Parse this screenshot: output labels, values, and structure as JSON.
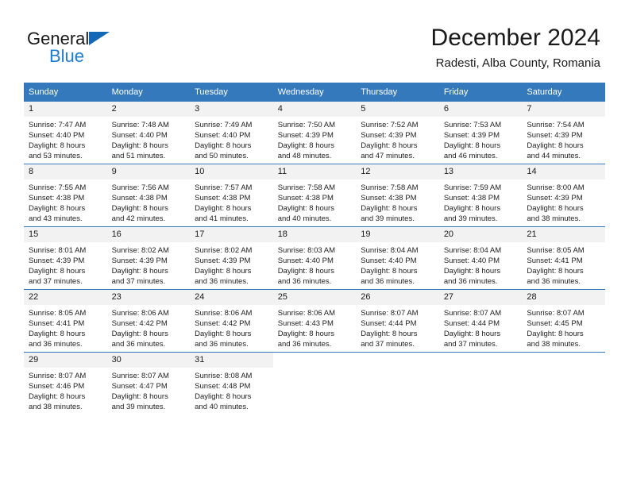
{
  "brand": {
    "word_one": "General",
    "word_two": "Blue",
    "flag_icon": "triangle-flag-icon",
    "accent_color": "#1568b4",
    "blue_text_color": "#1c7cd0"
  },
  "header": {
    "title": "December 2024",
    "subtitle": "Radesti, Alba County, Romania"
  },
  "theme": {
    "header_row_bg": "#3579bd",
    "header_row_text": "#ffffff",
    "daynum_bg": "#f2f2f2",
    "row_border": "#3579bd",
    "body_text": "#222222"
  },
  "calendar": {
    "weekday_headers": [
      "Sunday",
      "Monday",
      "Tuesday",
      "Wednesday",
      "Thursday",
      "Friday",
      "Saturday"
    ],
    "weeks": [
      [
        {
          "day": "1",
          "sunrise": "Sunrise: 7:47 AM",
          "sunset": "Sunset: 4:40 PM",
          "daylight_line1": "Daylight: 8 hours",
          "daylight_line2": "and 53 minutes."
        },
        {
          "day": "2",
          "sunrise": "Sunrise: 7:48 AM",
          "sunset": "Sunset: 4:40 PM",
          "daylight_line1": "Daylight: 8 hours",
          "daylight_line2": "and 51 minutes."
        },
        {
          "day": "3",
          "sunrise": "Sunrise: 7:49 AM",
          "sunset": "Sunset: 4:40 PM",
          "daylight_line1": "Daylight: 8 hours",
          "daylight_line2": "and 50 minutes."
        },
        {
          "day": "4",
          "sunrise": "Sunrise: 7:50 AM",
          "sunset": "Sunset: 4:39 PM",
          "daylight_line1": "Daylight: 8 hours",
          "daylight_line2": "and 48 minutes."
        },
        {
          "day": "5",
          "sunrise": "Sunrise: 7:52 AM",
          "sunset": "Sunset: 4:39 PM",
          "daylight_line1": "Daylight: 8 hours",
          "daylight_line2": "and 47 minutes."
        },
        {
          "day": "6",
          "sunrise": "Sunrise: 7:53 AM",
          "sunset": "Sunset: 4:39 PM",
          "daylight_line1": "Daylight: 8 hours",
          "daylight_line2": "and 46 minutes."
        },
        {
          "day": "7",
          "sunrise": "Sunrise: 7:54 AM",
          "sunset": "Sunset: 4:39 PM",
          "daylight_line1": "Daylight: 8 hours",
          "daylight_line2": "and 44 minutes."
        }
      ],
      [
        {
          "day": "8",
          "sunrise": "Sunrise: 7:55 AM",
          "sunset": "Sunset: 4:38 PM",
          "daylight_line1": "Daylight: 8 hours",
          "daylight_line2": "and 43 minutes."
        },
        {
          "day": "9",
          "sunrise": "Sunrise: 7:56 AM",
          "sunset": "Sunset: 4:38 PM",
          "daylight_line1": "Daylight: 8 hours",
          "daylight_line2": "and 42 minutes."
        },
        {
          "day": "10",
          "sunrise": "Sunrise: 7:57 AM",
          "sunset": "Sunset: 4:38 PM",
          "daylight_line1": "Daylight: 8 hours",
          "daylight_line2": "and 41 minutes."
        },
        {
          "day": "11",
          "sunrise": "Sunrise: 7:58 AM",
          "sunset": "Sunset: 4:38 PM",
          "daylight_line1": "Daylight: 8 hours",
          "daylight_line2": "and 40 minutes."
        },
        {
          "day": "12",
          "sunrise": "Sunrise: 7:58 AM",
          "sunset": "Sunset: 4:38 PM",
          "daylight_line1": "Daylight: 8 hours",
          "daylight_line2": "and 39 minutes."
        },
        {
          "day": "13",
          "sunrise": "Sunrise: 7:59 AM",
          "sunset": "Sunset: 4:38 PM",
          "daylight_line1": "Daylight: 8 hours",
          "daylight_line2": "and 39 minutes."
        },
        {
          "day": "14",
          "sunrise": "Sunrise: 8:00 AM",
          "sunset": "Sunset: 4:39 PM",
          "daylight_line1": "Daylight: 8 hours",
          "daylight_line2": "and 38 minutes."
        }
      ],
      [
        {
          "day": "15",
          "sunrise": "Sunrise: 8:01 AM",
          "sunset": "Sunset: 4:39 PM",
          "daylight_line1": "Daylight: 8 hours",
          "daylight_line2": "and 37 minutes."
        },
        {
          "day": "16",
          "sunrise": "Sunrise: 8:02 AM",
          "sunset": "Sunset: 4:39 PM",
          "daylight_line1": "Daylight: 8 hours",
          "daylight_line2": "and 37 minutes."
        },
        {
          "day": "17",
          "sunrise": "Sunrise: 8:02 AM",
          "sunset": "Sunset: 4:39 PM",
          "daylight_line1": "Daylight: 8 hours",
          "daylight_line2": "and 36 minutes."
        },
        {
          "day": "18",
          "sunrise": "Sunrise: 8:03 AM",
          "sunset": "Sunset: 4:40 PM",
          "daylight_line1": "Daylight: 8 hours",
          "daylight_line2": "and 36 minutes."
        },
        {
          "day": "19",
          "sunrise": "Sunrise: 8:04 AM",
          "sunset": "Sunset: 4:40 PM",
          "daylight_line1": "Daylight: 8 hours",
          "daylight_line2": "and 36 minutes."
        },
        {
          "day": "20",
          "sunrise": "Sunrise: 8:04 AM",
          "sunset": "Sunset: 4:40 PM",
          "daylight_line1": "Daylight: 8 hours",
          "daylight_line2": "and 36 minutes."
        },
        {
          "day": "21",
          "sunrise": "Sunrise: 8:05 AM",
          "sunset": "Sunset: 4:41 PM",
          "daylight_line1": "Daylight: 8 hours",
          "daylight_line2": "and 36 minutes."
        }
      ],
      [
        {
          "day": "22",
          "sunrise": "Sunrise: 8:05 AM",
          "sunset": "Sunset: 4:41 PM",
          "daylight_line1": "Daylight: 8 hours",
          "daylight_line2": "and 36 minutes."
        },
        {
          "day": "23",
          "sunrise": "Sunrise: 8:06 AM",
          "sunset": "Sunset: 4:42 PM",
          "daylight_line1": "Daylight: 8 hours",
          "daylight_line2": "and 36 minutes."
        },
        {
          "day": "24",
          "sunrise": "Sunrise: 8:06 AM",
          "sunset": "Sunset: 4:42 PM",
          "daylight_line1": "Daylight: 8 hours",
          "daylight_line2": "and 36 minutes."
        },
        {
          "day": "25",
          "sunrise": "Sunrise: 8:06 AM",
          "sunset": "Sunset: 4:43 PM",
          "daylight_line1": "Daylight: 8 hours",
          "daylight_line2": "and 36 minutes."
        },
        {
          "day": "26",
          "sunrise": "Sunrise: 8:07 AM",
          "sunset": "Sunset: 4:44 PM",
          "daylight_line1": "Daylight: 8 hours",
          "daylight_line2": "and 37 minutes."
        },
        {
          "day": "27",
          "sunrise": "Sunrise: 8:07 AM",
          "sunset": "Sunset: 4:44 PM",
          "daylight_line1": "Daylight: 8 hours",
          "daylight_line2": "and 37 minutes."
        },
        {
          "day": "28",
          "sunrise": "Sunrise: 8:07 AM",
          "sunset": "Sunset: 4:45 PM",
          "daylight_line1": "Daylight: 8 hours",
          "daylight_line2": "and 38 minutes."
        }
      ],
      [
        {
          "day": "29",
          "sunrise": "Sunrise: 8:07 AM",
          "sunset": "Sunset: 4:46 PM",
          "daylight_line1": "Daylight: 8 hours",
          "daylight_line2": "and 38 minutes."
        },
        {
          "day": "30",
          "sunrise": "Sunrise: 8:07 AM",
          "sunset": "Sunset: 4:47 PM",
          "daylight_line1": "Daylight: 8 hours",
          "daylight_line2": "and 39 minutes."
        },
        {
          "day": "31",
          "sunrise": "Sunrise: 8:08 AM",
          "sunset": "Sunset: 4:48 PM",
          "daylight_line1": "Daylight: 8 hours",
          "daylight_line2": "and 40 minutes."
        },
        {
          "day": "",
          "sunrise": "",
          "sunset": "",
          "daylight_line1": "",
          "daylight_line2": ""
        },
        {
          "day": "",
          "sunrise": "",
          "sunset": "",
          "daylight_line1": "",
          "daylight_line2": ""
        },
        {
          "day": "",
          "sunrise": "",
          "sunset": "",
          "daylight_line1": "",
          "daylight_line2": ""
        },
        {
          "day": "",
          "sunrise": "",
          "sunset": "",
          "daylight_line1": "",
          "daylight_line2": ""
        }
      ]
    ]
  }
}
